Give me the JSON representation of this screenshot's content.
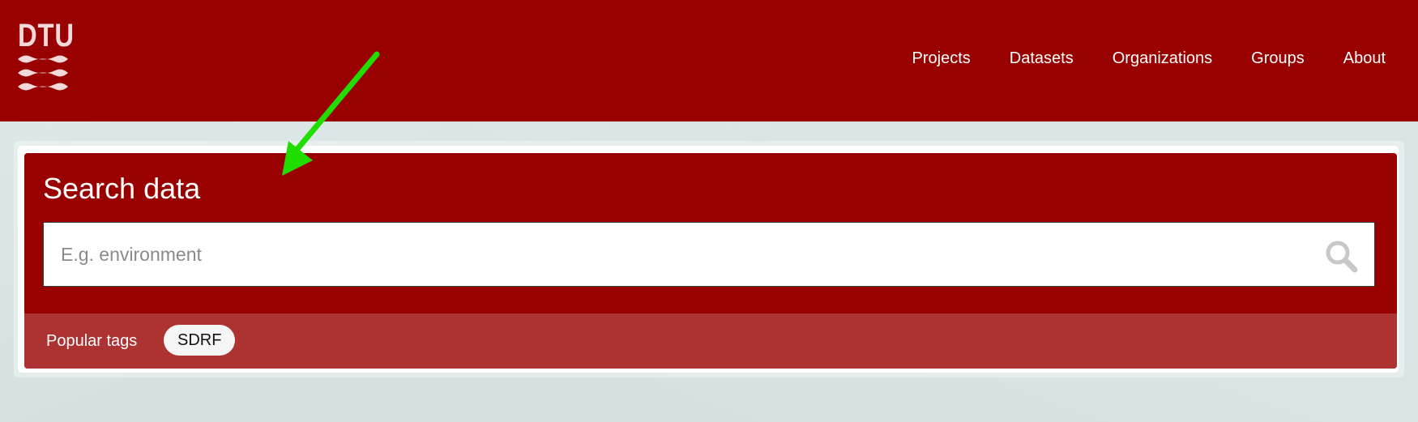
{
  "header": {
    "logo_text": "DTU",
    "nav": [
      {
        "label": "Projects"
      },
      {
        "label": "Datasets"
      },
      {
        "label": "Organizations"
      },
      {
        "label": "Groups"
      },
      {
        "label": "About"
      }
    ]
  },
  "search": {
    "title": "Search data",
    "placeholder": "E.g. environment",
    "value": "",
    "button_icon": "search-icon"
  },
  "popular_tags": {
    "label": "Popular tags",
    "tags": [
      {
        "label": "SDRF"
      }
    ]
  },
  "colors": {
    "brand_red": "#990000",
    "tags_bar": "#ad3333",
    "background": "#d6e2e2",
    "annotation_arrow": "#22dd00"
  },
  "annotation": {
    "icon": "arrow-icon"
  }
}
